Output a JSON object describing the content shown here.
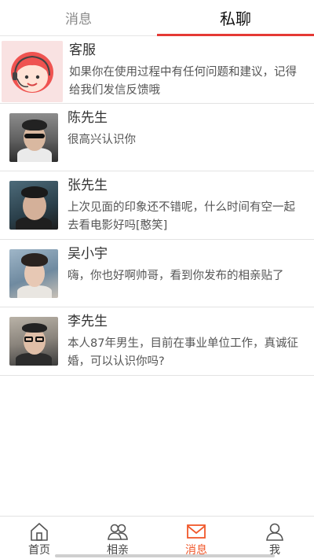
{
  "top_tabs": {
    "messages": "消息",
    "private_chat": "私聊"
  },
  "conversations": [
    {
      "name": "客服",
      "message": "如果你在使用过程中有任何问题和建议，记得给我们发信反馈哦",
      "avatar_icon": "customer-service-icon"
    },
    {
      "name": "陈先生",
      "message": "很高兴认识你"
    },
    {
      "name": "张先生",
      "message": "上次见面的印象还不错呢，什么时间有空一起去看电影好吗[憨笑]"
    },
    {
      "name": "吴小宇",
      "message": "嗨，你也好啊帅哥，看到你发布的相亲贴了"
    },
    {
      "name": "李先生",
      "message": "本人87年男生，目前在事业单位工作，真诚征婚，可以认识你吗?"
    }
  ],
  "bottom_nav": {
    "home": "首页",
    "matchmaking": "相亲",
    "messages": "消息",
    "me": "我"
  },
  "colors": {
    "accent_red": "#e53935",
    "active_nav": "#f0572a"
  }
}
